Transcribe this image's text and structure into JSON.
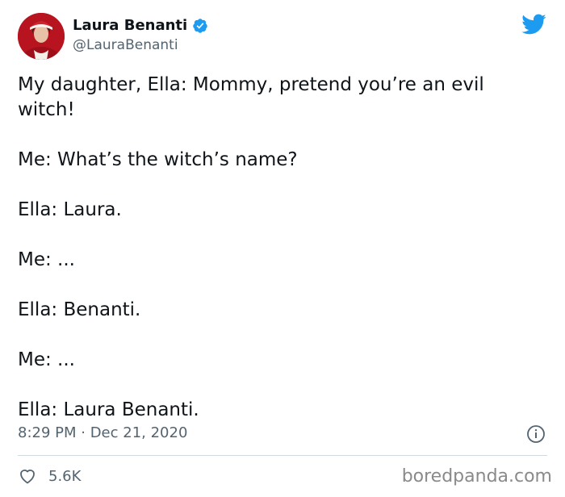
{
  "author": {
    "display_name": "Laura Benanti",
    "handle": "@LauraBenanti",
    "verified": true
  },
  "tweet": {
    "lines": [
      "My daughter, Ella: Mommy, pretend you’re an evil witch!",
      "Me: What’s the witch’s name?",
      "Ella: Laura.",
      "Me: ...",
      "Ella: Benanti.",
      "Me: ...",
      "Ella: Laura Benanti."
    ],
    "timestamp": "8:29 PM · Dec 21, 2020",
    "likes": "5.6K"
  },
  "watermark": "boredpanda.com",
  "colors": {
    "twitter_blue": "#1d9bf0",
    "muted_text": "#536471",
    "divider": "#cfd9de"
  },
  "icons": [
    "verified-badge-icon",
    "twitter-bird-icon",
    "info-icon",
    "heart-icon"
  ]
}
